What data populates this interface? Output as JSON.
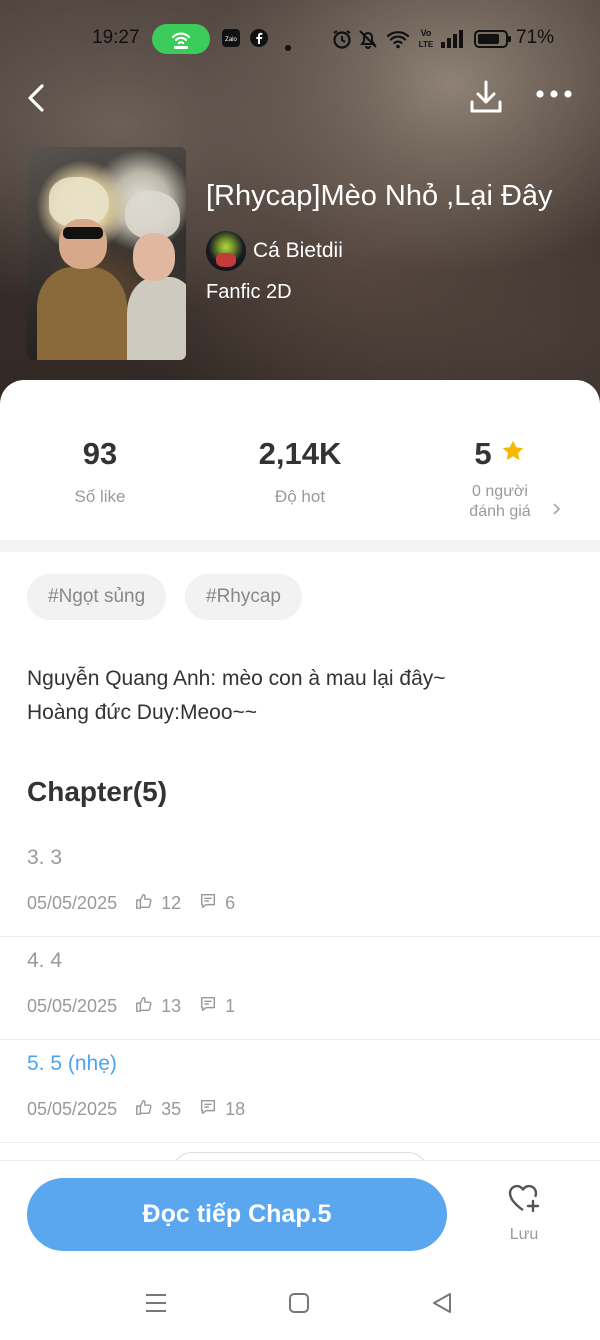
{
  "status_bar": {
    "time": "19:27",
    "battery": "71%",
    "notif_icons": [
      "hotspot-icon",
      "zalo-icon",
      "facebook-icon",
      "dot-icon",
      "alarm-icon",
      "mute-icon",
      "wifi-icon",
      "volte-icon",
      "signal-icon",
      "battery-icon"
    ]
  },
  "nav": {
    "icons": [
      "back-icon",
      "download-icon",
      "more-icon"
    ]
  },
  "story": {
    "title": "[Rhycap]Mèo Nhỏ ,Lại Đây",
    "author": "Cá Bietdii",
    "genre": "Fanfic 2D"
  },
  "stats": {
    "likes_value": "93",
    "likes_label": "Số like",
    "hot_value": "2,14K",
    "hot_label": "Độ hot",
    "rating_value": "5",
    "rating_label_line1": "0 người",
    "rating_label_line2": "đánh giá"
  },
  "tags": [
    "#Ngọt sủng",
    "#Rhycap"
  ],
  "description": {
    "line1": "Nguyễn Quang Anh: mèo con à mau lại đây~",
    "line2": "Hoàng đức Duy:Meoo~~"
  },
  "chapters_heading": "Chapter(5)",
  "chapters": [
    {
      "title": "3. 3",
      "date": "05/05/2025",
      "likes": "12",
      "comments": "6",
      "active": false
    },
    {
      "title": "4. 4",
      "date": "05/05/2025",
      "likes": "13",
      "comments": "1",
      "active": false
    },
    {
      "title": "5. 5 (nhẹ)",
      "date": "05/05/2025",
      "likes": "35",
      "comments": "18",
      "active": true
    }
  ],
  "bottom": {
    "read_button": "Đọc tiếp Chap.5",
    "save_label": "Lưu"
  },
  "colors": {
    "accent": "#5aa7f0",
    "active_chapter": "#4ea3ee",
    "star": "#f5b800",
    "hotspot": "#3ccc5a"
  }
}
